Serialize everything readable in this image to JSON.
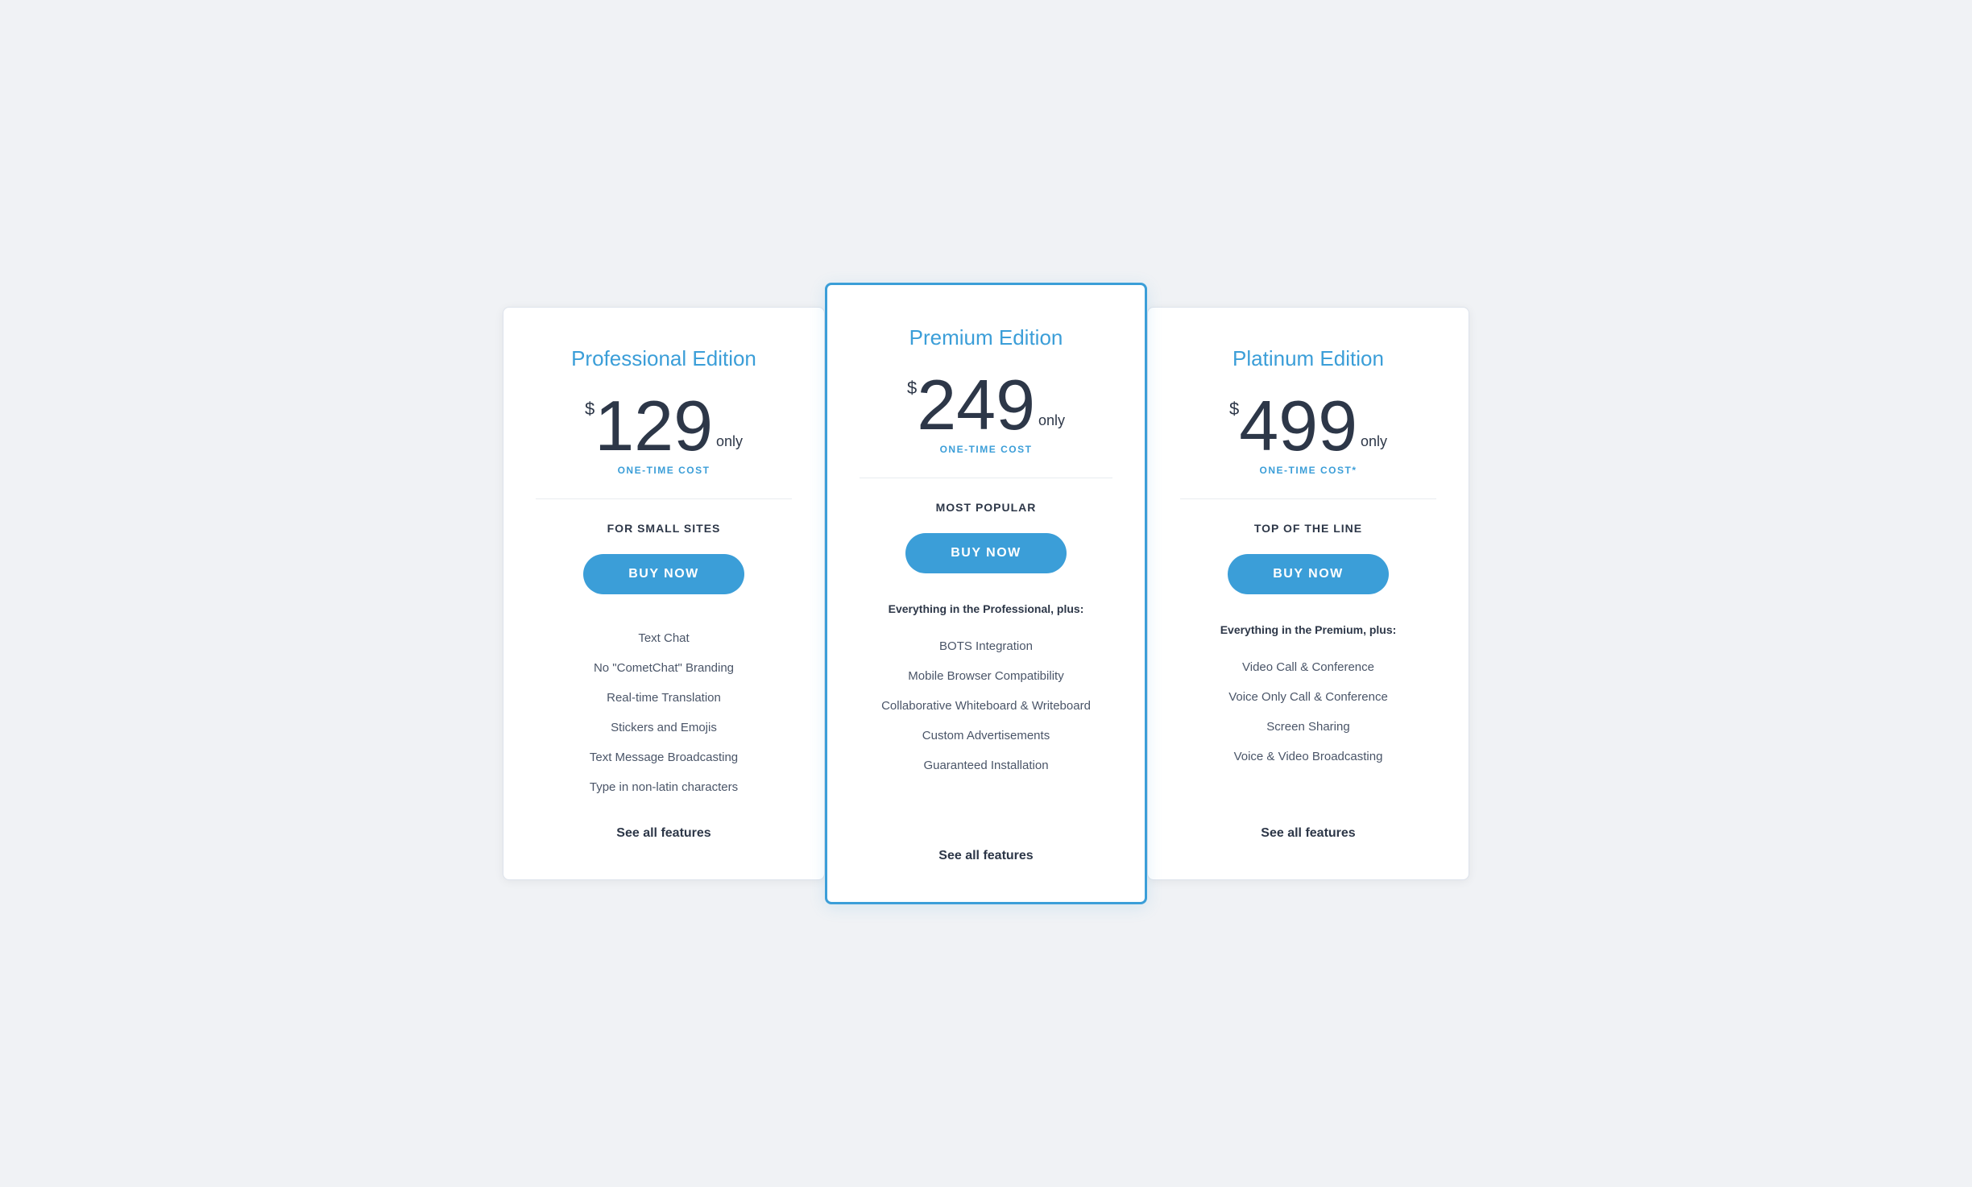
{
  "plans": [
    {
      "id": "professional",
      "title": "Professional Edition",
      "currency": "$",
      "price": "129",
      "suffix": "only",
      "one_time": "ONE-TIME COST",
      "subtitle": "FOR SMALL SITES",
      "buy_label": "BUY NOW",
      "featured": false,
      "features_intro": null,
      "features": [
        "Text Chat",
        "No \"CometChat\" Branding",
        "Real-time Translation",
        "Stickers and Emojis",
        "Text Message Broadcasting",
        "Type in non-latin characters"
      ],
      "see_all": "See all features"
    },
    {
      "id": "premium",
      "title": "Premium Edition",
      "currency": "$",
      "price": "249",
      "suffix": "only",
      "one_time": "ONE-TIME COST",
      "subtitle": "MOST POPULAR",
      "buy_label": "BUY NOW",
      "featured": true,
      "features_intro": "Everything in the Professional, plus:",
      "features": [
        "BOTS Integration",
        "Mobile Browser Compatibility",
        "Collaborative Whiteboard & Writeboard",
        "Custom Advertisements",
        "Guaranteed Installation"
      ],
      "see_all": "See all features"
    },
    {
      "id": "platinum",
      "title": "Platinum Edition",
      "currency": "$",
      "price": "499",
      "suffix": "only",
      "one_time": "ONE-TIME COST*",
      "subtitle": "TOP OF THE LINE",
      "buy_label": "BUY NOW",
      "featured": false,
      "features_intro": "Everything in the Premium, plus:",
      "features": [
        "Video Call & Conference",
        "Voice Only Call & Conference",
        "Screen Sharing",
        "Voice & Video Broadcasting"
      ],
      "see_all": "See all features"
    }
  ]
}
